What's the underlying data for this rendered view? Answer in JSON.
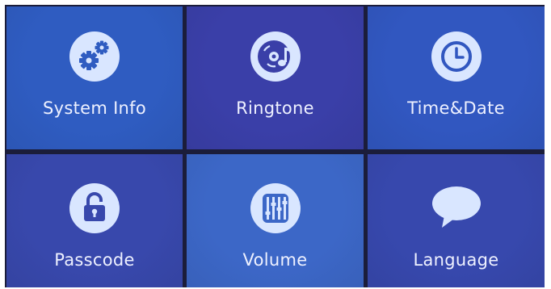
{
  "menu": {
    "tiles": [
      {
        "label": "System Info",
        "icon": "gears-icon",
        "color": "#2f5cc1"
      },
      {
        "label": "Ringtone",
        "icon": "music-disc-icon",
        "color": "#3a3fa8"
      },
      {
        "label": "Time&Date",
        "icon": "clock-icon",
        "color": "#3157c0"
      },
      {
        "label": "Passcode",
        "icon": "lock-icon",
        "color": "#3848ac"
      },
      {
        "label": "Volume",
        "icon": "volume-sliders-icon",
        "color": "#3c67c7"
      },
      {
        "label": "Language",
        "icon": "speech-bubble-icon",
        "color": "#3748ad"
      }
    ],
    "icon_color": "#d9e6ff"
  }
}
